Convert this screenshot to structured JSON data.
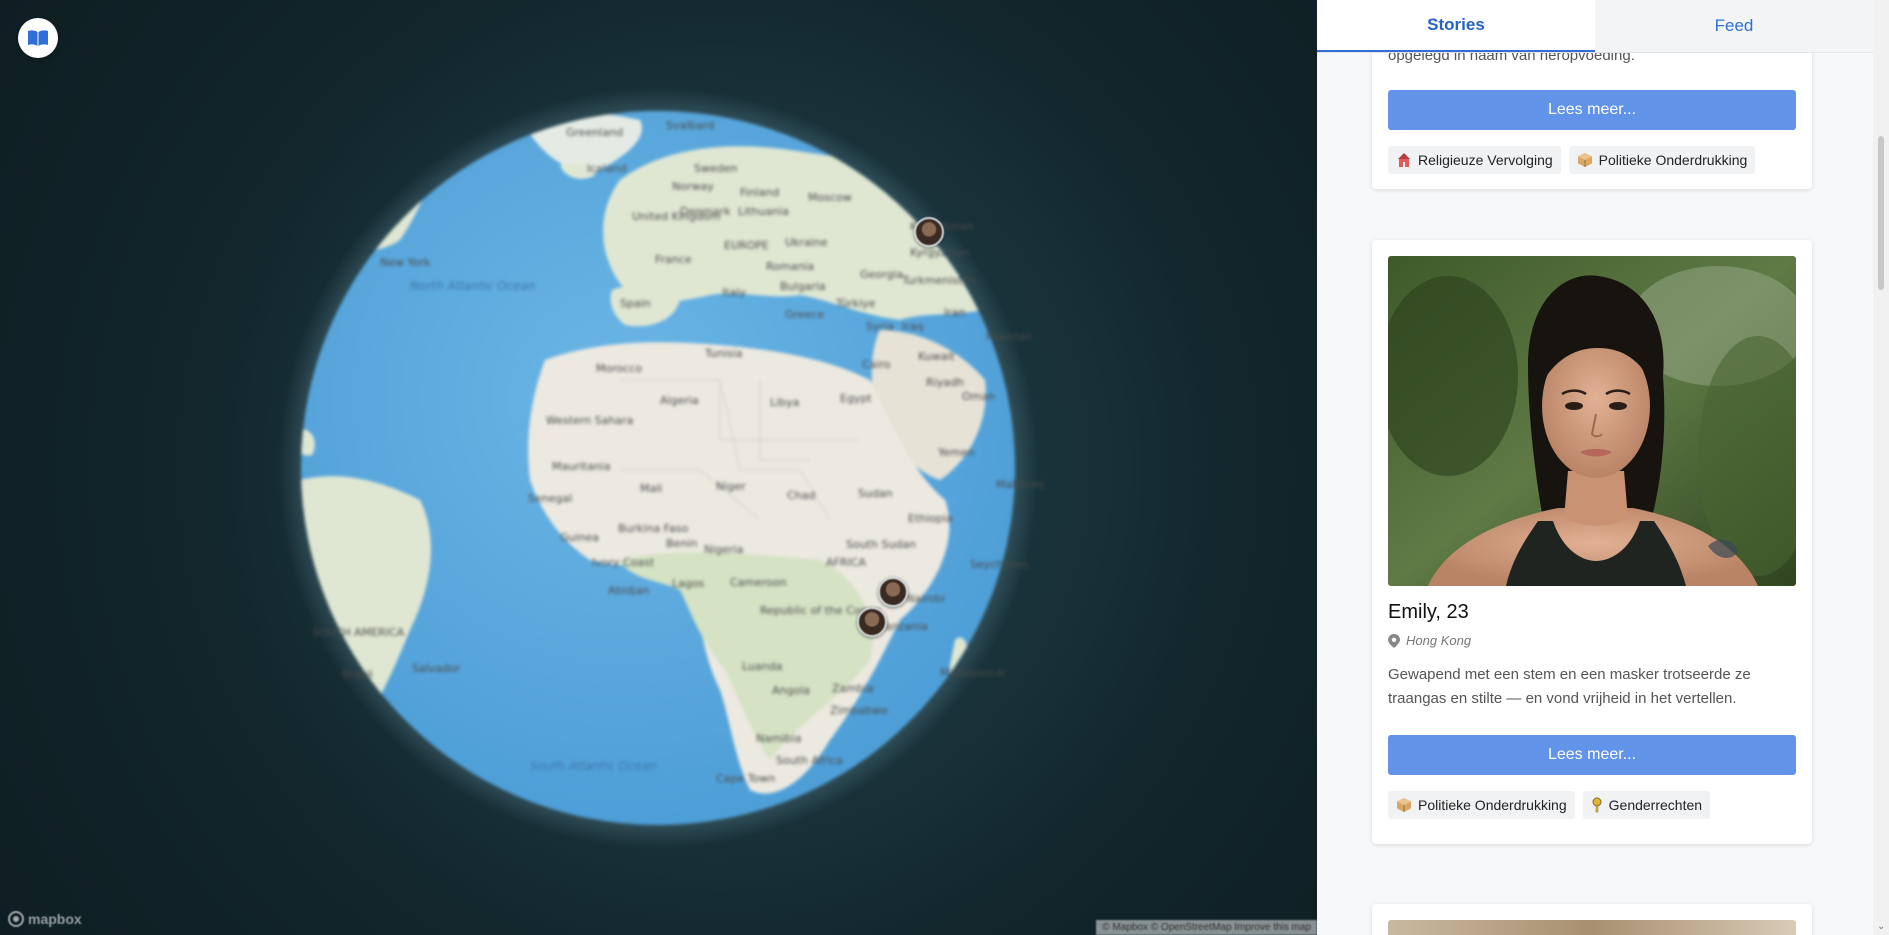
{
  "map": {
    "labels": {
      "greenland": "Greenland",
      "svalbard": "Svalbard",
      "iceland": "Iceland",
      "sweden": "Sweden",
      "norway": "Norway",
      "finland": "Finland",
      "moscow": "Moscow",
      "denmark": "Denmark",
      "lithuania": "Lithuania",
      "united_kingdom": "United Kingdom",
      "kazakhstan": "Kazakhstan",
      "france": "France",
      "europe": "EUROPE",
      "ukraine": "Ukraine",
      "romania": "Romania",
      "bulgaria": "Bulgaria",
      "italy": "Italy",
      "spain": "Spain",
      "greece": "Greece",
      "turkiye": "Türkiye",
      "syria": "Syria",
      "new_york": "New York",
      "north_atlantic_ocean": "North Atlantic Ocean",
      "morocco": "Morocco",
      "tunisia": "Tunisia",
      "algeria": "Algeria",
      "libya": "Libya",
      "egypt": "Egypt",
      "cairo": "Cairo",
      "kuwait": "Kuwait",
      "riyadh": "Riyadh",
      "western_sahara": "Western Sahara",
      "mauritania": "Mauritania",
      "mali": "Mali",
      "niger": "Niger",
      "chad": "Chad",
      "sudan": "Sudan",
      "senegal": "Senegal",
      "burkina_faso": "Burkina Faso",
      "benin": "Benin",
      "nigeria": "Nigeria",
      "guinea": "Guinea",
      "ivory_coast": "Ivory Coast",
      "abidjan": "Abidjan",
      "lagos": "Lagos",
      "cameroon": "Cameroon",
      "south_sudan": "South Sudan",
      "ethiopia": "Ethiopia",
      "africa": "AFRICA",
      "republic_congo": "Republic of the Congo",
      "tanzania": "Tanzania",
      "luanda": "Luanda",
      "angola": "Angola",
      "zambia": "Zambia",
      "zimbabwe": "Zimbabwe",
      "namibia": "Namibia",
      "south_africa": "South Africa",
      "cape_town": "Cape Town",
      "south_atlantic_ocean": "South Atlantic Ocean",
      "south_america": "SOUTH AMERICA",
      "brazil": "Brazil",
      "salvador": "Salvador",
      "yemen": "Yemen",
      "oman": "Oman",
      "maldives": "Maldives",
      "madagascar": "Madagascar",
      "seychelles": "Seychelles",
      "kyrgyzstan": "Kyrgyzstan",
      "georgia": "Georgia",
      "turkmenistan": "Turkmenistan",
      "iraq": "Iraq",
      "iran": "Iran",
      "pakistan": "Pakistan",
      "nairobi": "Nairobi"
    },
    "mapbox_label": "mapbox",
    "attribution": "© Mapbox © OpenStreetMap Improve this map"
  },
  "tabs": {
    "stories": "Stories",
    "feed": "Feed"
  },
  "story_prev": {
    "snippet_tail": "opgelegd in naam van heropvoeding.",
    "read_more": "Lees meer...",
    "tags": [
      "Religieuze Vervolging",
      "Politieke Onderdrukking"
    ]
  },
  "story_emily": {
    "name": "Emily, 23",
    "location": "Hong Kong",
    "snippet": "Gewapend met een stem en een masker trotseerde ze traangas en stilte — en vond vrijheid in het vertellen.",
    "read_more": "Lees meer...",
    "tags": [
      "Politieke Onderdrukking",
      "Genderrechten"
    ]
  },
  "colors": {
    "accent": "#2f6fd6",
    "button": "#6193e8",
    "ocean": "#5aa7db",
    "land": "#dfe7d3"
  }
}
